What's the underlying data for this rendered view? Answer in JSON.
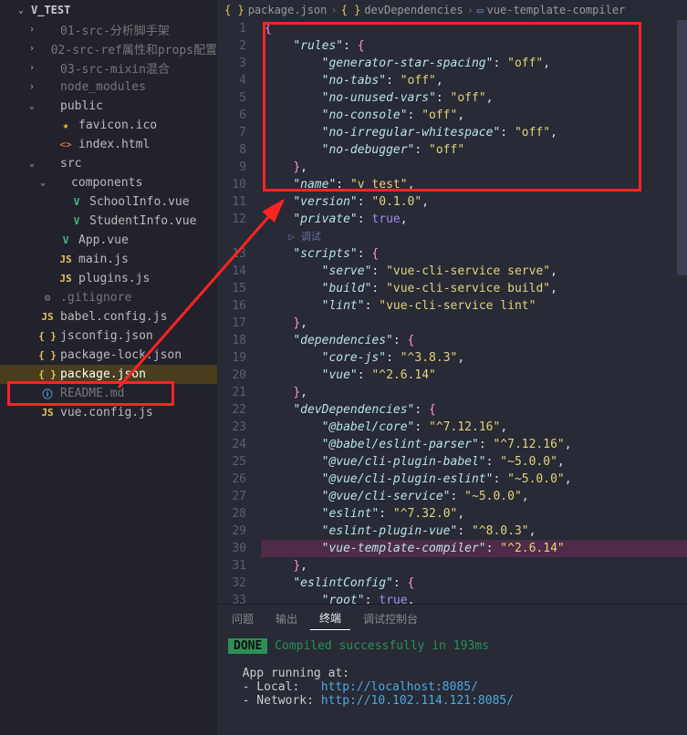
{
  "sidebar": {
    "root": "V_TEST",
    "items": [
      {
        "label": "01-src-分析脚手架",
        "indent": 32,
        "chev": ">",
        "icon": "folder",
        "dim": true
      },
      {
        "label": "02-src-ref属性和props配置",
        "indent": 32,
        "chev": ">",
        "icon": "folder",
        "dim": true
      },
      {
        "label": "03-src-mixin混合",
        "indent": 32,
        "chev": ">",
        "icon": "folder",
        "dim": true
      },
      {
        "label": "node_modules",
        "indent": 32,
        "chev": ">",
        "icon": "folder",
        "dim": true
      },
      {
        "label": "public",
        "indent": 32,
        "chev": "v",
        "icon": "folder"
      },
      {
        "label": "favicon.ico",
        "indent": 52,
        "icon": "star"
      },
      {
        "label": "index.html",
        "indent": 52,
        "icon": "html"
      },
      {
        "label": "src",
        "indent": 32,
        "chev": "v",
        "icon": "folder"
      },
      {
        "label": "components",
        "indent": 44,
        "chev": "v",
        "icon": "folder"
      },
      {
        "label": "SchoolInfo.vue",
        "indent": 64,
        "icon": "vue"
      },
      {
        "label": "StudentInfo.vue",
        "indent": 64,
        "icon": "vue"
      },
      {
        "label": "App.vue",
        "indent": 52,
        "icon": "vue"
      },
      {
        "label": "main.js",
        "indent": 52,
        "icon": "js"
      },
      {
        "label": "plugins.js",
        "indent": 52,
        "icon": "js"
      },
      {
        "label": ".gitignore",
        "indent": 32,
        "icon": "conf",
        "dim": true
      },
      {
        "label": "babel.config.js",
        "indent": 32,
        "icon": "js"
      },
      {
        "label": "jsconfig.json",
        "indent": 32,
        "icon": "json"
      },
      {
        "label": "package-lock.json",
        "indent": 32,
        "icon": "json"
      },
      {
        "label": "package.json",
        "indent": 32,
        "icon": "json",
        "selected": true
      },
      {
        "label": "README.md",
        "indent": 32,
        "icon": "info",
        "dim": true
      },
      {
        "label": "vue.config.js",
        "indent": 32,
        "icon": "js"
      }
    ]
  },
  "breadcrumb": {
    "seg1": "package.json",
    "seg2": "devDependencies",
    "seg3": "vue-template-compiler"
  },
  "codelens": "调试",
  "code": {
    "lines": [
      [
        {
          "t": "brace",
          "v": "{"
        }
      ],
      [
        {
          "t": "sp",
          "v": "    "
        },
        {
          "t": "key",
          "v": "\"rules\""
        },
        {
          "t": "punc",
          "v": ": "
        },
        {
          "t": "brace",
          "v": "{"
        }
      ],
      [
        {
          "t": "sp",
          "v": "        "
        },
        {
          "t": "key",
          "v": "\"generator-star-spacing\""
        },
        {
          "t": "punc",
          "v": ": "
        },
        {
          "t": "str",
          "v": "\"off\""
        },
        {
          "t": "punc",
          "v": ","
        }
      ],
      [
        {
          "t": "sp",
          "v": "        "
        },
        {
          "t": "key",
          "v": "\"no-tabs\""
        },
        {
          "t": "punc",
          "v": ": "
        },
        {
          "t": "str",
          "v": "\"off\""
        },
        {
          "t": "punc",
          "v": ","
        }
      ],
      [
        {
          "t": "sp",
          "v": "        "
        },
        {
          "t": "key",
          "v": "\"no-unused-vars\""
        },
        {
          "t": "punc",
          "v": ": "
        },
        {
          "t": "str",
          "v": "\"off\""
        },
        {
          "t": "punc",
          "v": ","
        }
      ],
      [
        {
          "t": "sp",
          "v": "        "
        },
        {
          "t": "key",
          "v": "\"no-console\""
        },
        {
          "t": "punc",
          "v": ": "
        },
        {
          "t": "str",
          "v": "\"off\""
        },
        {
          "t": "punc",
          "v": ","
        }
      ],
      [
        {
          "t": "sp",
          "v": "        "
        },
        {
          "t": "key",
          "v": "\"no-irregular-whitespace\""
        },
        {
          "t": "punc",
          "v": ": "
        },
        {
          "t": "str",
          "v": "\"off\""
        },
        {
          "t": "punc",
          "v": ","
        }
      ],
      [
        {
          "t": "sp",
          "v": "        "
        },
        {
          "t": "key",
          "v": "\"no-debugger\""
        },
        {
          "t": "punc",
          "v": ": "
        },
        {
          "t": "str",
          "v": "\"off\""
        }
      ],
      [
        {
          "t": "sp",
          "v": "    "
        },
        {
          "t": "brace",
          "v": "}"
        },
        {
          "t": "punc",
          "v": ","
        }
      ],
      [
        {
          "t": "sp",
          "v": "    "
        },
        {
          "t": "key",
          "v": "\"name\""
        },
        {
          "t": "punc",
          "v": ": "
        },
        {
          "t": "str",
          "v": "\"v_test\""
        },
        {
          "t": "punc",
          "v": ","
        }
      ],
      [
        {
          "t": "sp",
          "v": "    "
        },
        {
          "t": "key",
          "v": "\"version\""
        },
        {
          "t": "punc",
          "v": ": "
        },
        {
          "t": "str",
          "v": "\"0.1.0\""
        },
        {
          "t": "punc",
          "v": ","
        }
      ],
      [
        {
          "t": "sp",
          "v": "    "
        },
        {
          "t": "key",
          "v": "\"private\""
        },
        {
          "t": "punc",
          "v": ": "
        },
        {
          "t": "kw",
          "v": "true"
        },
        {
          "t": "punc",
          "v": ","
        }
      ],
      [
        {
          "t": "sp",
          "v": "    "
        },
        {
          "t": "key",
          "v": "\"scripts\""
        },
        {
          "t": "punc",
          "v": ": "
        },
        {
          "t": "brace",
          "v": "{"
        }
      ],
      [
        {
          "t": "sp",
          "v": "        "
        },
        {
          "t": "key",
          "v": "\"serve\""
        },
        {
          "t": "punc",
          "v": ": "
        },
        {
          "t": "str",
          "v": "\"vue-cli-service serve\""
        },
        {
          "t": "punc",
          "v": ","
        }
      ],
      [
        {
          "t": "sp",
          "v": "        "
        },
        {
          "t": "key",
          "v": "\"build\""
        },
        {
          "t": "punc",
          "v": ": "
        },
        {
          "t": "str",
          "v": "\"vue-cli-service build\""
        },
        {
          "t": "punc",
          "v": ","
        }
      ],
      [
        {
          "t": "sp",
          "v": "        "
        },
        {
          "t": "key",
          "v": "\"lint\""
        },
        {
          "t": "punc",
          "v": ": "
        },
        {
          "t": "str",
          "v": "\"vue-cli-service lint\""
        }
      ],
      [
        {
          "t": "sp",
          "v": "    "
        },
        {
          "t": "brace",
          "v": "}"
        },
        {
          "t": "punc",
          "v": ","
        }
      ],
      [
        {
          "t": "sp",
          "v": "    "
        },
        {
          "t": "key",
          "v": "\"dependencies\""
        },
        {
          "t": "punc",
          "v": ": "
        },
        {
          "t": "brace",
          "v": "{"
        }
      ],
      [
        {
          "t": "sp",
          "v": "        "
        },
        {
          "t": "key",
          "v": "\"core-js\""
        },
        {
          "t": "punc",
          "v": ": "
        },
        {
          "t": "str",
          "v": "\"^3.8.3\""
        },
        {
          "t": "punc",
          "v": ","
        }
      ],
      [
        {
          "t": "sp",
          "v": "        "
        },
        {
          "t": "key",
          "v": "\"vue\""
        },
        {
          "t": "punc",
          "v": ": "
        },
        {
          "t": "str",
          "v": "\"^2.6.14\""
        }
      ],
      [
        {
          "t": "sp",
          "v": "    "
        },
        {
          "t": "brace",
          "v": "}"
        },
        {
          "t": "punc",
          "v": ","
        }
      ],
      [
        {
          "t": "sp",
          "v": "    "
        },
        {
          "t": "key",
          "v": "\"devDependencies\""
        },
        {
          "t": "punc",
          "v": ": "
        },
        {
          "t": "brace",
          "v": "{"
        }
      ],
      [
        {
          "t": "sp",
          "v": "        "
        },
        {
          "t": "key",
          "v": "\"@babel/core\""
        },
        {
          "t": "punc",
          "v": ": "
        },
        {
          "t": "str",
          "v": "\"^7.12.16\""
        },
        {
          "t": "punc",
          "v": ","
        }
      ],
      [
        {
          "t": "sp",
          "v": "        "
        },
        {
          "t": "key",
          "v": "\"@babel/eslint-parser\""
        },
        {
          "t": "punc",
          "v": ": "
        },
        {
          "t": "str",
          "v": "\"^7.12.16\""
        },
        {
          "t": "punc",
          "v": ","
        }
      ],
      [
        {
          "t": "sp",
          "v": "        "
        },
        {
          "t": "key",
          "v": "\"@vue/cli-plugin-babel\""
        },
        {
          "t": "punc",
          "v": ": "
        },
        {
          "t": "str",
          "v": "\"~5.0.0\""
        },
        {
          "t": "punc",
          "v": ","
        }
      ],
      [
        {
          "t": "sp",
          "v": "        "
        },
        {
          "t": "key",
          "v": "\"@vue/cli-plugin-eslint\""
        },
        {
          "t": "punc",
          "v": ": "
        },
        {
          "t": "str",
          "v": "\"~5.0.0\""
        },
        {
          "t": "punc",
          "v": ","
        }
      ],
      [
        {
          "t": "sp",
          "v": "        "
        },
        {
          "t": "key",
          "v": "\"@vue/cli-service\""
        },
        {
          "t": "punc",
          "v": ": "
        },
        {
          "t": "str",
          "v": "\"~5.0.0\""
        },
        {
          "t": "punc",
          "v": ","
        }
      ],
      [
        {
          "t": "sp",
          "v": "        "
        },
        {
          "t": "key",
          "v": "\"eslint\""
        },
        {
          "t": "punc",
          "v": ": "
        },
        {
          "t": "str",
          "v": "\"^7.32.0\""
        },
        {
          "t": "punc",
          "v": ","
        }
      ],
      [
        {
          "t": "sp",
          "v": "        "
        },
        {
          "t": "key",
          "v": "\"eslint-plugin-vue\""
        },
        {
          "t": "punc",
          "v": ": "
        },
        {
          "t": "str",
          "v": "\"^8.0.3\""
        },
        {
          "t": "punc",
          "v": ","
        }
      ],
      [
        {
          "t": "sp",
          "v": "        "
        },
        {
          "t": "key",
          "v": "\"vue-template-compiler\""
        },
        {
          "t": "punc",
          "v": ": "
        },
        {
          "t": "str",
          "v": "\"^2.6.14\""
        }
      ],
      [
        {
          "t": "sp",
          "v": "    "
        },
        {
          "t": "brace",
          "v": "}"
        },
        {
          "t": "punc",
          "v": ","
        }
      ],
      [
        {
          "t": "sp",
          "v": "    "
        },
        {
          "t": "key",
          "v": "\"eslintConfig\""
        },
        {
          "t": "punc",
          "v": ": "
        },
        {
          "t": "brace",
          "v": "{"
        }
      ],
      [
        {
          "t": "sp",
          "v": "        "
        },
        {
          "t": "key",
          "v": "\"root\""
        },
        {
          "t": "punc",
          "v": ": "
        },
        {
          "t": "kw",
          "v": "true"
        },
        {
          "t": "punc",
          "v": ","
        }
      ]
    ],
    "highlight_line": 30,
    "codelens_after_line": 12
  },
  "panel": {
    "tabs": [
      "问题",
      "输出",
      "终端",
      "调试控制台"
    ],
    "active": 2,
    "done_label": "DONE",
    "done_msg": "Compiled successfully in 193ms",
    "app_running": "App running at:",
    "local_label": "- Local:   ",
    "local_url": "http://localhost:8085/",
    "network_label": "- Network: ",
    "network_url": "http://10.102.114.121:8085/"
  }
}
